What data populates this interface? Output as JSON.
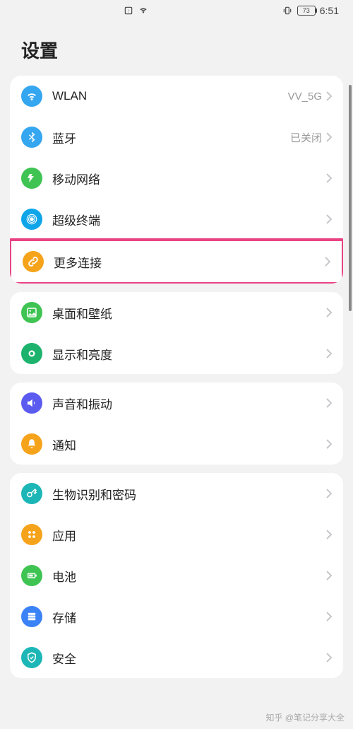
{
  "status": {
    "battery": "73",
    "time": "6:51"
  },
  "title": "设置",
  "groups": [
    [
      {
        "key": "wlan",
        "label": "WLAN",
        "value": "VV_5G",
        "icon": "wifi-icon",
        "color": "#35a6f0"
      },
      {
        "key": "bluetooth",
        "label": "蓝牙",
        "value": "已关闭",
        "icon": "bluetooth-icon",
        "color": "#35a6f0"
      },
      {
        "key": "mobile",
        "label": "移动网络",
        "value": "",
        "icon": "mobile-network-icon",
        "color": "#3fc453"
      },
      {
        "key": "superdevice",
        "label": "超级终端",
        "value": "",
        "icon": "super-device-icon",
        "color": "#0ea5e9"
      },
      {
        "key": "more",
        "label": "更多连接",
        "value": "",
        "icon": "link-icon",
        "color": "#f6a31c",
        "highlighted": true
      }
    ],
    [
      {
        "key": "wallpaper",
        "label": "桌面和壁纸",
        "value": "",
        "icon": "wallpaper-icon",
        "color": "#3fc453"
      },
      {
        "key": "display",
        "label": "显示和亮度",
        "value": "",
        "icon": "brightness-icon",
        "color": "#1db36d"
      }
    ],
    [
      {
        "key": "sound",
        "label": "声音和振动",
        "value": "",
        "icon": "sound-icon",
        "color": "#5b5bf0"
      },
      {
        "key": "notify",
        "label": "通知",
        "value": "",
        "icon": "bell-icon",
        "color": "#f6a31c"
      }
    ],
    [
      {
        "key": "biometric",
        "label": "生物识别和密码",
        "value": "",
        "icon": "key-icon",
        "color": "#1db6b6"
      },
      {
        "key": "apps",
        "label": "应用",
        "value": "",
        "icon": "apps-icon",
        "color": "#f6a31c"
      },
      {
        "key": "battery",
        "label": "电池",
        "value": "",
        "icon": "battery-icon",
        "color": "#3fc453"
      },
      {
        "key": "storage",
        "label": "存储",
        "value": "",
        "icon": "storage-icon",
        "color": "#3b82f6"
      },
      {
        "key": "security",
        "label": "安全",
        "value": "",
        "icon": "shield-icon",
        "color": "#1db6b6"
      }
    ]
  ],
  "watermark": "知乎 @笔记分享大全"
}
